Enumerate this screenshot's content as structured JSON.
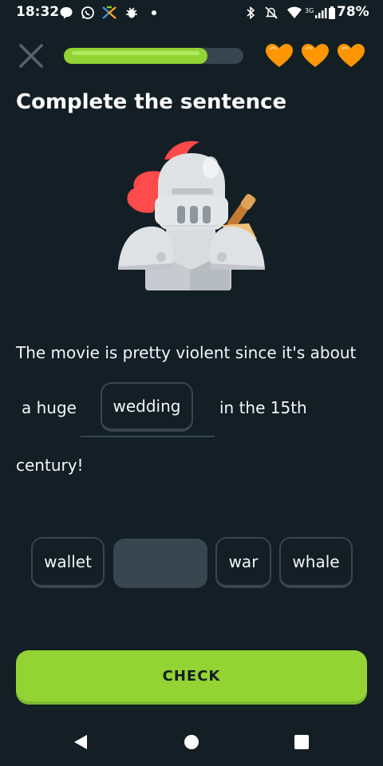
{
  "status_bar": {
    "time": "18:32",
    "battery": "78%",
    "network": "3G",
    "icons": [
      "chat-bubble-icon",
      "whatsapp-icon",
      "app-x-icon",
      "bug-icon",
      "dot-icon",
      "bluetooth-icon",
      "mute-icon",
      "wifi-icon",
      "signal-icon",
      "battery-icon"
    ]
  },
  "header": {
    "close_icon": "close-icon",
    "progress": 0.8,
    "hearts": 3,
    "colors": {
      "progress_fill": "#93d333",
      "progress_track": "#37464f",
      "heart": "#ff9600"
    }
  },
  "lesson": {
    "title": "Complete the sentence",
    "illustration": "knight-armor-illustration",
    "sentence": {
      "line1": "The movie is pretty violent since it's about",
      "before_blank": "a huge",
      "answer": "wedding",
      "after_blank": "in the 15th",
      "line3": "century!"
    },
    "word_bank": [
      {
        "label": "wallet",
        "used": false
      },
      {
        "label": "wedding",
        "used": true
      },
      {
        "label": "war",
        "used": false
      },
      {
        "label": "whale",
        "used": false
      }
    ]
  },
  "actions": {
    "check_label": "CHECK",
    "check_color": "#93d333"
  },
  "nav_bar": {
    "items": [
      "back-icon",
      "home-icon",
      "recents-icon"
    ]
  },
  "theme": {
    "background": "#131f24",
    "border": "#37464f",
    "text": "#f1f7fb"
  }
}
